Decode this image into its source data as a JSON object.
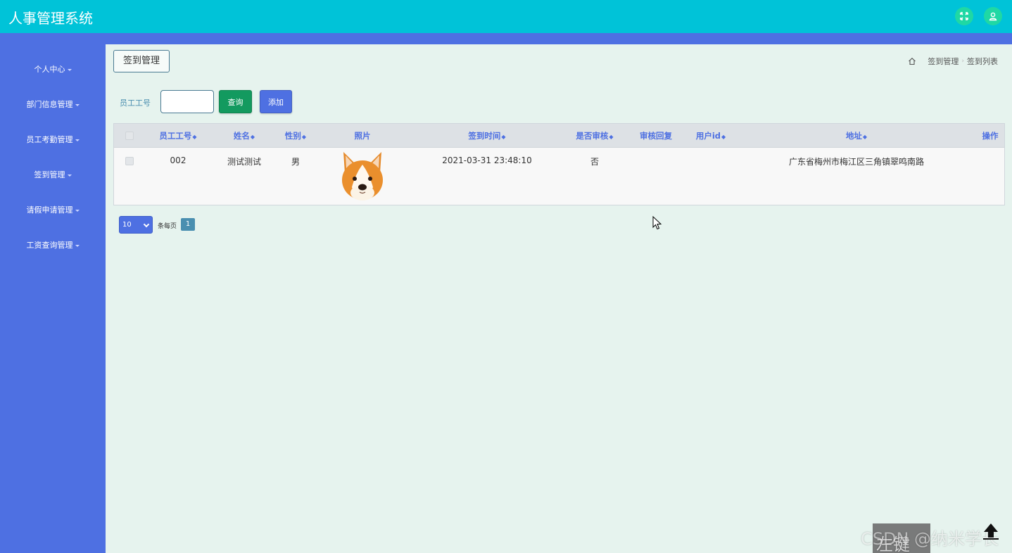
{
  "app": {
    "title": "人事管理系统"
  },
  "header_icons": [
    "fullscreen-icon",
    "user-icon"
  ],
  "sidebar": {
    "items": [
      {
        "label": "个人中心"
      },
      {
        "label": "部门信息管理"
      },
      {
        "label": "员工考勤管理"
      },
      {
        "label": "签到管理"
      },
      {
        "label": "请假申请管理"
      },
      {
        "label": "工资查询管理"
      }
    ]
  },
  "page": {
    "title": "签到管理",
    "breadcrumb": [
      "签到管理",
      "签到列表"
    ]
  },
  "search": {
    "label": "员工工号",
    "value": "",
    "query_label": "查询",
    "add_label": "添加"
  },
  "table": {
    "columns": [
      "员工工号",
      "姓名",
      "性别",
      "照片",
      "签到时间",
      "是否审核",
      "审核回复",
      "用户id",
      "地址",
      "操作"
    ],
    "rows": [
      {
        "emp_no": "002",
        "name": "测试测试",
        "gender": "男",
        "signin_time": "2021-03-31 23:48:10",
        "reviewed": "否",
        "review_reply": "",
        "user_id": "",
        "address": "广东省梅州市梅江区三角镇翠鸣南路"
      }
    ]
  },
  "pagination": {
    "page_size": "10",
    "per_page_label": "条每页",
    "current_page": "1"
  },
  "overlay": {
    "watermark": "CSDN @纳米学长",
    "watermark_left": "左键"
  },
  "colors": {
    "topbar": "#00c3d8",
    "sidebar": "#4e70e2",
    "query_button": "#139a5f",
    "add_button": "#4e70e2"
  }
}
